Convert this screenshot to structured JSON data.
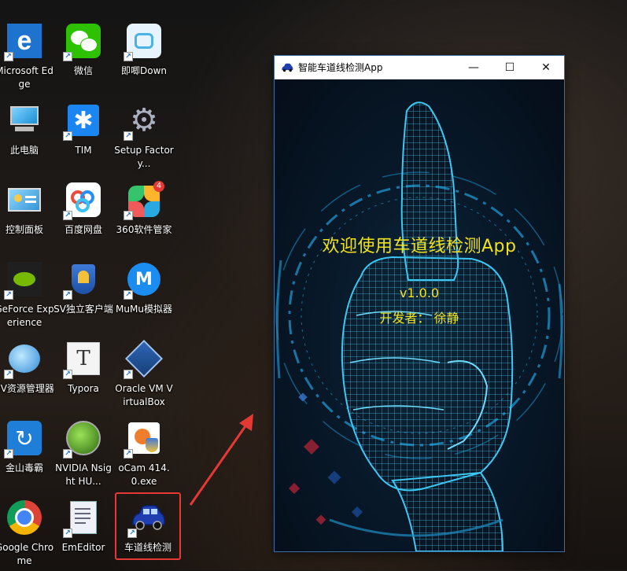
{
  "desktop": {
    "icons": [
      {
        "label": "Microsoft Edge",
        "icon": "edge-icon"
      },
      {
        "label": "微信",
        "icon": "wechat-icon"
      },
      {
        "label": "即唧Down",
        "icon": "bilibili-down-icon"
      },
      {
        "label": "此电脑",
        "icon": "computer-icon"
      },
      {
        "label": "TIM",
        "icon": "tim-icon"
      },
      {
        "label": "Setup Factory...",
        "icon": "setup-factory-icon"
      },
      {
        "label": "控制面板",
        "icon": "control-panel-icon"
      },
      {
        "label": "百度网盘",
        "icon": "baidu-netdisk-icon"
      },
      {
        "label": "360软件管家",
        "icon": "360-software-icon"
      },
      {
        "label": "GeForce Experience",
        "icon": "geforce-icon"
      },
      {
        "label": "SV独立客户端",
        "icon": "sv-client-icon"
      },
      {
        "label": "MuMu模拟器",
        "icon": "mumu-icon"
      },
      {
        "label": "SV资源管理器",
        "icon": "sv-resource-icon"
      },
      {
        "label": "Typora",
        "icon": "typora-icon"
      },
      {
        "label": "Oracle VM VirtualBox",
        "icon": "virtualbox-icon"
      },
      {
        "label": "金山毒霸",
        "icon": "kingsoft-icon"
      },
      {
        "label": "NVIDIA Nsight HU...",
        "icon": "nvidia-nsight-icon"
      },
      {
        "label": "oCam 414.0.exe",
        "icon": "ocam-icon"
      },
      {
        "label": "Google Chrome",
        "icon": "chrome-icon"
      },
      {
        "label": "EmEditor",
        "icon": "emeditor-icon"
      },
      {
        "label": "车道线检测",
        "icon": "car-icon"
      }
    ],
    "badge_360": "4",
    "annotation_color": "#e53935"
  },
  "window": {
    "title": "智能车道线检测App",
    "minimize_glyph": "—",
    "maximize_glyph": "☐",
    "close_glyph": "✕",
    "welcome": "欢迎使用车道线检测App",
    "version": "v1.0.0",
    "developer": "开发者： 徐静",
    "text_color": "#f2e21a",
    "hand_color": "#2fb8e8"
  }
}
